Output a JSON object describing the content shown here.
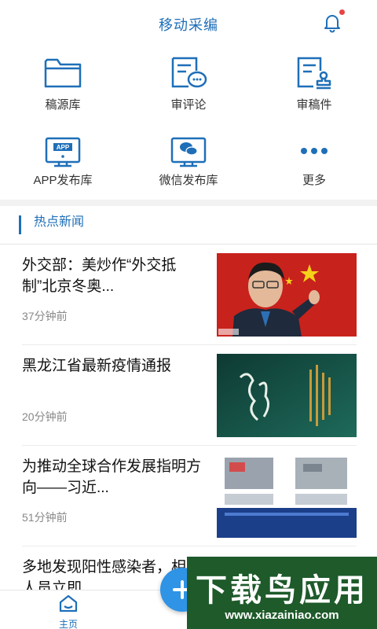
{
  "header": {
    "title": "移动采编"
  },
  "grid": {
    "items": [
      {
        "label": "稿源库",
        "icon": "folder-icon"
      },
      {
        "label": "审评论",
        "icon": "comment-review-icon"
      },
      {
        "label": "审稿件",
        "icon": "manuscript-approve-icon"
      },
      {
        "label": "APP发布库",
        "icon": "app-publish-icon"
      },
      {
        "label": "微信发布库",
        "icon": "wechat-publish-icon"
      },
      {
        "label": "更多",
        "icon": "more-icon"
      }
    ]
  },
  "news": {
    "section_title": "热点新闻",
    "items": [
      {
        "title": "外交部：美炒作“外交抵制”北京冬奥...",
        "time": "37分钟前"
      },
      {
        "title": "黑龙江省最新疫情通报",
        "time": "20分钟前"
      },
      {
        "title": "为推动全球合作发展指明方向——习近...",
        "time": "51分钟前"
      },
      {
        "title": "多地发现阳性感染者，相关人员立即...",
        "time": ""
      }
    ]
  },
  "tabbar": {
    "home_label": "主页"
  },
  "watermark": {
    "main": "下载鸟应用",
    "sub": "www.xiazainiao.com"
  },
  "colors": {
    "accent": "#1e6fb8",
    "text": "#111111",
    "muted": "#888888"
  }
}
